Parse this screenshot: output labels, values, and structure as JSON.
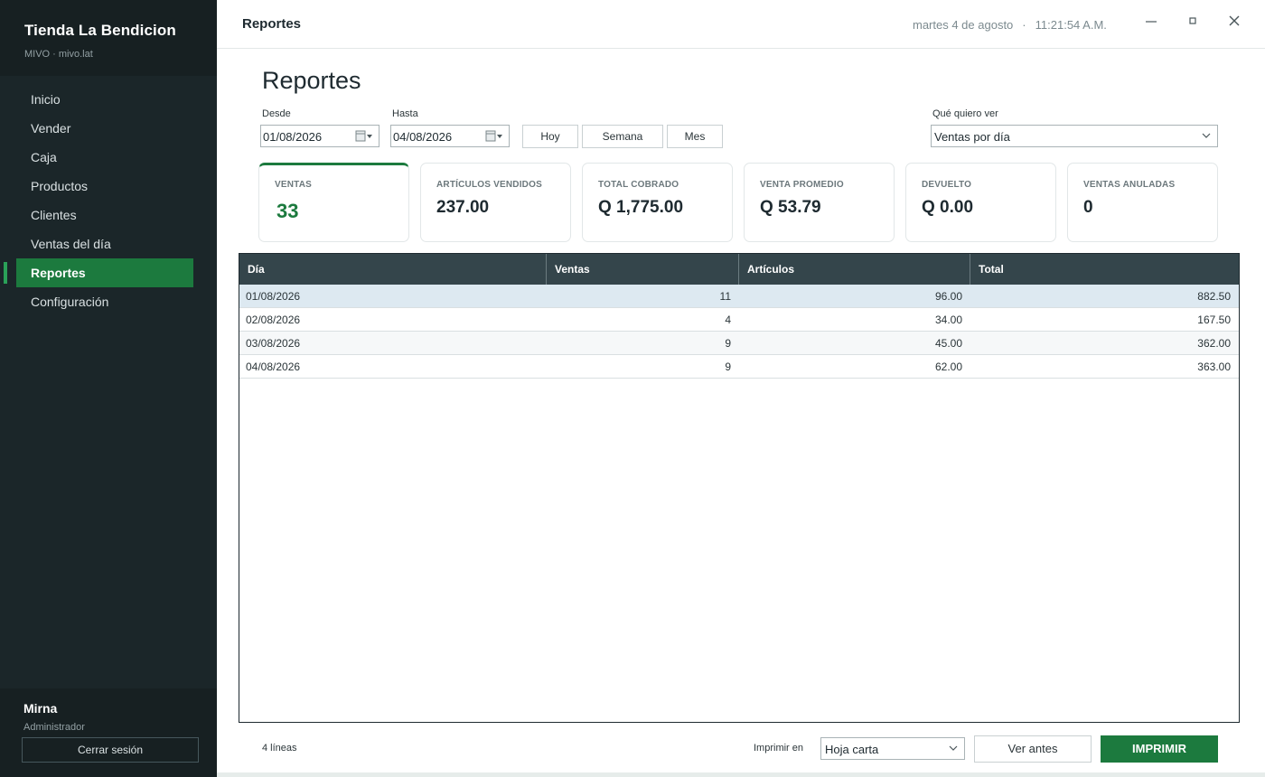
{
  "sidebar": {
    "brand_name": "Tienda La Bendicion",
    "brand_sub": "MIVO · mivo.lat",
    "items": [
      {
        "label": "Inicio"
      },
      {
        "label": "Vender"
      },
      {
        "label": "Caja"
      },
      {
        "label": "Productos"
      },
      {
        "label": "Clientes"
      },
      {
        "label": "Ventas del día"
      },
      {
        "label": "Reportes"
      },
      {
        "label": "Configuración"
      }
    ],
    "user_name": "Mirna",
    "user_role": "Administrador",
    "logout_label": "Cerrar sesión"
  },
  "topbar": {
    "title": "Reportes",
    "date": "martes 4 de agosto",
    "separator": "·",
    "time": "11:21:54 A.M."
  },
  "main": {
    "title": "Reportes",
    "from_label": "Desde",
    "from_value": "01/08/2026",
    "to_label": "Hasta",
    "to_value": "04/08/2026",
    "quick": [
      "Hoy",
      "Semana",
      "Mes"
    ],
    "view_label": "Qué quiero ver",
    "view_value": "Ventas por día"
  },
  "kpis": [
    {
      "label": "VENTAS",
      "value": "33"
    },
    {
      "label": "ARTÍCULOS VENDIDOS",
      "value": "237.00"
    },
    {
      "label": "TOTAL COBRADO",
      "value": "Q 1,775.00"
    },
    {
      "label": "VENTA PROMEDIO",
      "value": "Q 53.79"
    },
    {
      "label": "DEVUELTO",
      "value": "Q 0.00"
    },
    {
      "label": "VENTAS ANULADAS",
      "value": "0"
    }
  ],
  "table": {
    "headers": [
      "Día",
      "Ventas",
      "Artículos",
      "Total"
    ],
    "rows": [
      [
        "01/08/2026",
        "11",
        "96.00",
        "882.50"
      ],
      [
        "02/08/2026",
        "4",
        "34.00",
        "167.50"
      ],
      [
        "03/08/2026",
        "9",
        "45.00",
        "362.00"
      ],
      [
        "04/08/2026",
        "9",
        "62.00",
        "363.00"
      ]
    ]
  },
  "footer": {
    "lines_count": "4 líneas",
    "print_label": "Imprimir en",
    "print_value": "Hoja carta",
    "preview_label": "Ver antes",
    "print_button": "IMPRIMIR"
  },
  "colors": {
    "accent": "#1c7a3e",
    "sidebar": "#1b2629",
    "table_header": "#34454b"
  }
}
